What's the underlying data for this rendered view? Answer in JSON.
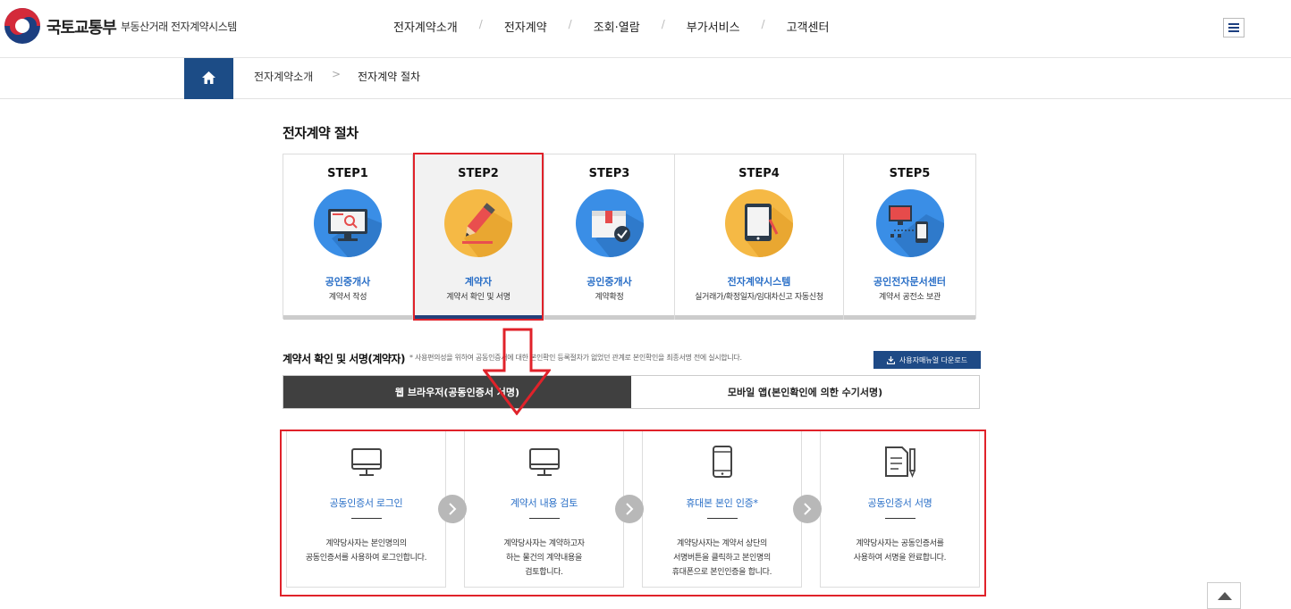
{
  "header": {
    "ministry": "국토교통부",
    "system_name": "부동산거래 전자계약시스템",
    "nav": [
      {
        "label": "전자계약소개"
      },
      {
        "label": "전자계약"
      },
      {
        "label": "조회·열람"
      },
      {
        "label": "부가서비스"
      },
      {
        "label": "고객센터"
      }
    ],
    "nav_separator": "/"
  },
  "breadcrumb": {
    "items": [
      "전자계약소개",
      "전자계약 절차"
    ],
    "separator": ">"
  },
  "page_title": "전자계약 절차",
  "steps": [
    {
      "no": "STEP1",
      "role": "공인중개사",
      "desc": "계약서 작성",
      "icon": "monitor-search-icon"
    },
    {
      "no": "STEP2",
      "role": "계약자",
      "desc": "계약서 확인 및 서명",
      "icon": "pen-sign-icon",
      "active": true
    },
    {
      "no": "STEP3",
      "role": "공인중개사",
      "desc": "계약확정",
      "icon": "contract-confirm-icon"
    },
    {
      "no": "STEP4",
      "role": "전자계약시스템",
      "desc": "실거래가/확정일자/임대차신고 자동신청",
      "icon": "tablet-icon"
    },
    {
      "no": "STEP5",
      "role": "공인전자문서센터",
      "desc": "계약서 공전소 보관",
      "icon": "computer-storage-icon"
    }
  ],
  "section": {
    "title": "계약서 확인 및 서명(계약자)",
    "note": "* 사용편의성을 위하여 공동인증서에 대한 본인확인 등록절차가 없었던 관계로 본인확인을 최종서명 전에 실시합니다.",
    "manual_button": "사용자매뉴얼 다운로드"
  },
  "tabs": [
    {
      "label": "웹 브라우저(공동인증서 서명)",
      "active": true
    },
    {
      "label": "모바일 앱(본인확인에 의한 수기서명)",
      "active": false
    }
  ],
  "procedure": [
    {
      "title": "공동인증서 로그인",
      "lines": [
        "계약당사자는 본인명의의",
        "공동인증서를 사용하여 로그인합니다."
      ],
      "icon": "monitor-icon"
    },
    {
      "title": "계약서 내용 검토",
      "lines": [
        "계약당사자는 계약하고자",
        "하는 물건의 계약내용을",
        "검토합니다."
      ],
      "icon": "monitor-icon"
    },
    {
      "title": "휴대본 본인 인증*",
      "lines": [
        "계약당사자는 계약서 상단의",
        "서명버튼을 클릭하고 본인명의",
        "휴대폰으로 본인인증을 합니다."
      ],
      "icon": "smartphone-icon"
    },
    {
      "title": "공동인증서 서명",
      "lines": [
        "계약당사자는 공동인증서를",
        "사용하여 서명을 완료합니다."
      ],
      "icon": "document-pen-icon"
    }
  ],
  "colors": {
    "brand_blue": "#1c4c86",
    "highlight_red": "#e0222a",
    "link_blue": "#2a6fc7",
    "tab_active": "#404040"
  }
}
